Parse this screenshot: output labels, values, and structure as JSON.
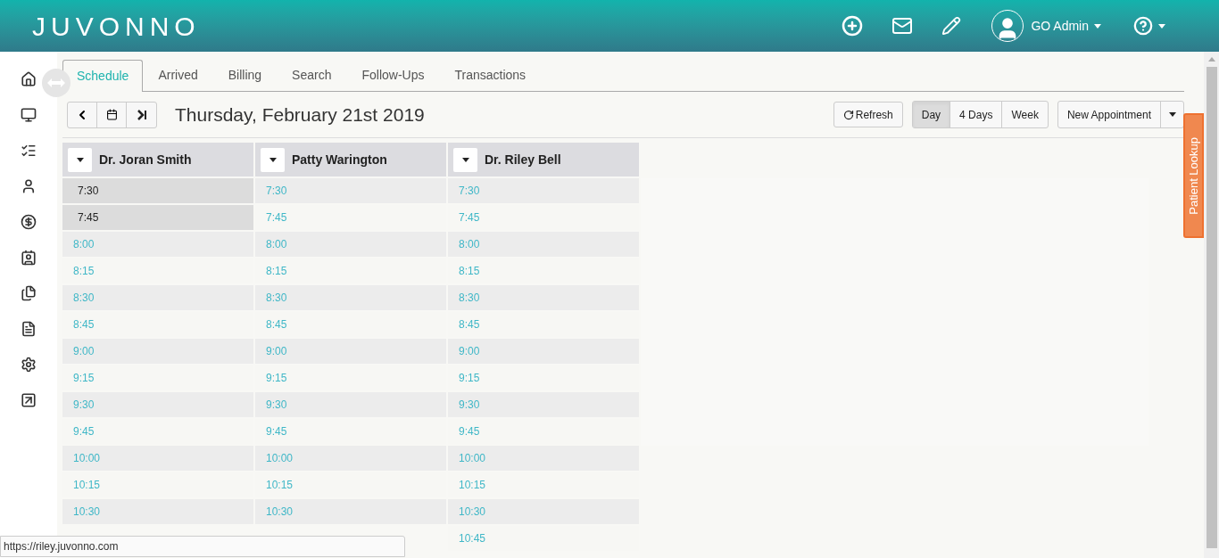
{
  "header": {
    "logo": "JUVONNO",
    "user": "GO Admin"
  },
  "tabs": [
    {
      "label": "Schedule",
      "selected": true
    },
    {
      "label": "Arrived",
      "selected": false
    },
    {
      "label": "Billing",
      "selected": false
    },
    {
      "label": "Search",
      "selected": false
    },
    {
      "label": "Follow-Ups",
      "selected": false
    },
    {
      "label": "Transactions",
      "selected": false
    }
  ],
  "toolbar": {
    "date": "Thursday, February 21st 2019",
    "refresh": "Refresh",
    "views": [
      {
        "label": "Day",
        "selected": true
      },
      {
        "label": "4 Days",
        "selected": false
      },
      {
        "label": "Week",
        "selected": false
      }
    ],
    "new_appointment": "New Appointment"
  },
  "providers": [
    {
      "name": "Dr. Joran Smith",
      "slots": [
        {
          "time": "7:30",
          "blocked": true
        },
        {
          "time": "7:45",
          "blocked": true
        },
        {
          "time": "8:00",
          "blocked": false
        },
        {
          "time": "8:15",
          "blocked": false
        },
        {
          "time": "8:30",
          "blocked": false
        },
        {
          "time": "8:45",
          "blocked": false
        },
        {
          "time": "9:00",
          "blocked": false
        },
        {
          "time": "9:15",
          "blocked": false
        },
        {
          "time": "9:30",
          "blocked": false
        },
        {
          "time": "9:45",
          "blocked": false
        },
        {
          "time": "10:00",
          "blocked": false
        },
        {
          "time": "10:15",
          "blocked": false
        },
        {
          "time": "10:30",
          "blocked": false
        }
      ]
    },
    {
      "name": "Patty Warington",
      "slots": [
        {
          "time": "7:30",
          "blocked": false
        },
        {
          "time": "7:45",
          "blocked": false
        },
        {
          "time": "8:00",
          "blocked": false
        },
        {
          "time": "8:15",
          "blocked": false
        },
        {
          "time": "8:30",
          "blocked": false
        },
        {
          "time": "8:45",
          "blocked": false
        },
        {
          "time": "9:00",
          "blocked": false
        },
        {
          "time": "9:15",
          "blocked": false
        },
        {
          "time": "9:30",
          "blocked": false
        },
        {
          "time": "9:45",
          "blocked": false
        },
        {
          "time": "10:00",
          "blocked": false
        },
        {
          "time": "10:15",
          "blocked": false
        },
        {
          "time": "10:30",
          "blocked": false
        }
      ]
    },
    {
      "name": "Dr. Riley Bell",
      "slots": [
        {
          "time": "7:30",
          "blocked": false
        },
        {
          "time": "7:45",
          "blocked": false
        },
        {
          "time": "8:00",
          "blocked": false
        },
        {
          "time": "8:15",
          "blocked": false
        },
        {
          "time": "8:30",
          "blocked": false
        },
        {
          "time": "8:45",
          "blocked": false
        },
        {
          "time": "9:00",
          "blocked": false
        },
        {
          "time": "9:15",
          "blocked": false
        },
        {
          "time": "9:30",
          "blocked": false
        },
        {
          "time": "9:45",
          "blocked": false
        },
        {
          "time": "10:00",
          "blocked": false
        },
        {
          "time": "10:15",
          "blocked": false
        },
        {
          "time": "10:30",
          "blocked": false
        },
        {
          "time": "10:45",
          "blocked": false
        }
      ]
    }
  ],
  "side_tab": "Patient Lookup",
  "status_url": "https://riley.juvonno.com"
}
